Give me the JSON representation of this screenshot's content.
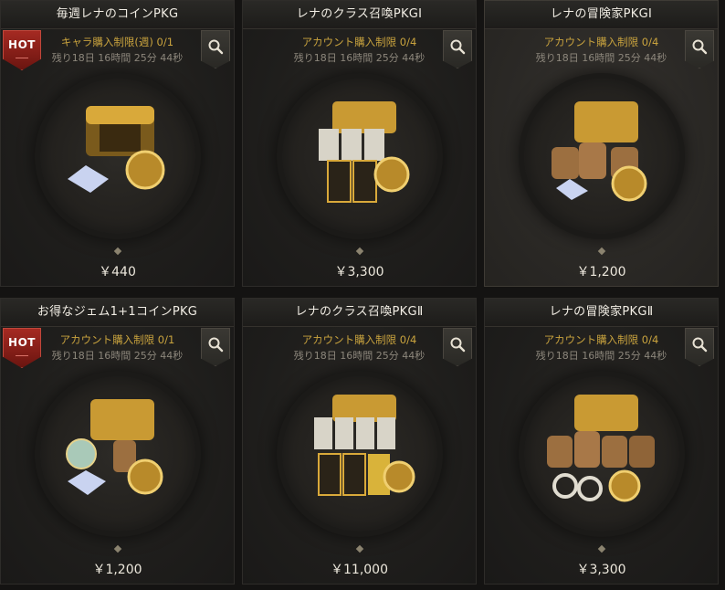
{
  "cards": [
    {
      "title": "毎週レナのコインPKG",
      "limit": "キャラ購入制限(週) 0/1",
      "timer": "残り18日 16時間 25分 44秒",
      "price": "￥440",
      "hot": true,
      "hot_label": "HOT",
      "contents": "chest-coin-diamond"
    },
    {
      "title": "レナのクラス召喚PKGⅠ",
      "limit": "アカウント購入制限 0/4",
      "timer": "残り18日 16時間 25分 44秒",
      "price": "￥3,300",
      "hot": false,
      "contents": "chest-cards"
    },
    {
      "title": "レナの冒険家PKGⅠ",
      "limit": "アカウント購入制限 0/4",
      "timer": "残り18日 16時間 25分 44秒",
      "price": "￥1,200",
      "hot": false,
      "contents": "chest-bags"
    },
    {
      "title": "お得なジェム1+1コインPKG",
      "limit": "アカウント購入制限 0/1",
      "timer": "残り18日 16時間 25分 44秒",
      "price": "￥1,200",
      "hot": true,
      "hot_label": "HOT",
      "contents": "chest-gems"
    },
    {
      "title": "レナのクラス召喚PKGⅡ",
      "limit": "アカウント購入制限 0/4",
      "timer": "残り18日 16時間 25分 44秒",
      "price": "￥11,000",
      "hot": false,
      "contents": "chest-cards-large"
    },
    {
      "title": "レナの冒険家PKGⅡ",
      "limit": "アカウント購入制限 0/4",
      "timer": "残り18日 16時間 25分 44秒",
      "price": "￥3,300",
      "hot": false,
      "contents": "chest-bags-large"
    }
  ],
  "colors": {
    "limit_text": "#c9a33e",
    "hot_badge": "#a52a22",
    "gold": "#d9a93a"
  },
  "icons": {
    "search": "magnifier-icon",
    "hot": "hot-badge"
  }
}
